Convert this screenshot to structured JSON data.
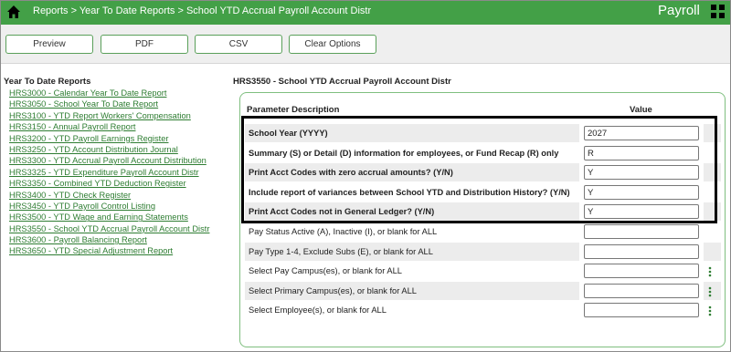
{
  "header": {
    "breadcrumb": "Reports > Year To Date Reports > School YTD Accrual Payroll Account Distr",
    "app_title": "Payroll",
    "home_icon": "home-icon",
    "grid_icon": "grid-icon"
  },
  "toolbar": {
    "preview": "Preview",
    "pdf": "PDF",
    "csv": "CSV",
    "clear": "Clear Options"
  },
  "menu": {
    "title": "Year To Date Reports",
    "items": [
      "HRS3000 - Calendar Year To Date Report",
      "HRS3050 - School Year To Date Report",
      "HRS3100 - YTD Report Workers' Compensation",
      "HRS3150 - Annual Payroll Report",
      "HRS3200 - YTD Payroll Earnings Register",
      "HRS3250 - YTD Account Distribution Journal",
      "HRS3300 - YTD Accrual Payroll Account Distribution",
      "HRS3325 - YTD Expenditure Payroll Account Distr",
      "HRS3350 - Combined YTD Deduction Register",
      "HRS3400 - YTD Check Register",
      "HRS3450 - YTD Payroll Control Listing",
      "HRS3500 - YTD Wage and Earning Statements",
      "HRS3550 - School YTD Accrual Payroll Account Distr",
      "HRS3600 - Payroll Balancing Report",
      "HRS3650 - YTD Special Adjustment Report"
    ]
  },
  "report": {
    "title": "HRS3550 - School YTD Accrual Payroll Account Distr",
    "col_param": "Parameter Description",
    "col_value": "Value",
    "params": [
      {
        "label": "School Year (YYYY)",
        "value": "2027"
      },
      {
        "label": "Summary (S) or Detail (D) information for employees, or Fund Recap (R) only",
        "value": "R"
      },
      {
        "label": "Print Acct Codes with zero accrual amounts? (Y/N)",
        "value": "Y"
      },
      {
        "label": "Include report of variances between School YTD and Distribution History? (Y/N)",
        "value": "Y"
      },
      {
        "label": "Print Acct Codes not in General Ledger? (Y/N)",
        "value": "Y"
      },
      {
        "label": "Pay Status Active (A), Inactive (I), or blank for ALL",
        "value": ""
      },
      {
        "label": "Pay Type 1-4, Exclude Subs (E), or blank for ALL",
        "value": ""
      },
      {
        "label": "Select Pay Campus(es), or blank for ALL",
        "value": ""
      },
      {
        "label": "Select Primary Campus(es), or blank for ALL",
        "value": ""
      },
      {
        "label": "Select Employee(s), or blank for ALL",
        "value": ""
      }
    ]
  },
  "colors": {
    "header_green": "#43a047",
    "link_green": "#2e7d32",
    "row_shade": "#ececec"
  }
}
